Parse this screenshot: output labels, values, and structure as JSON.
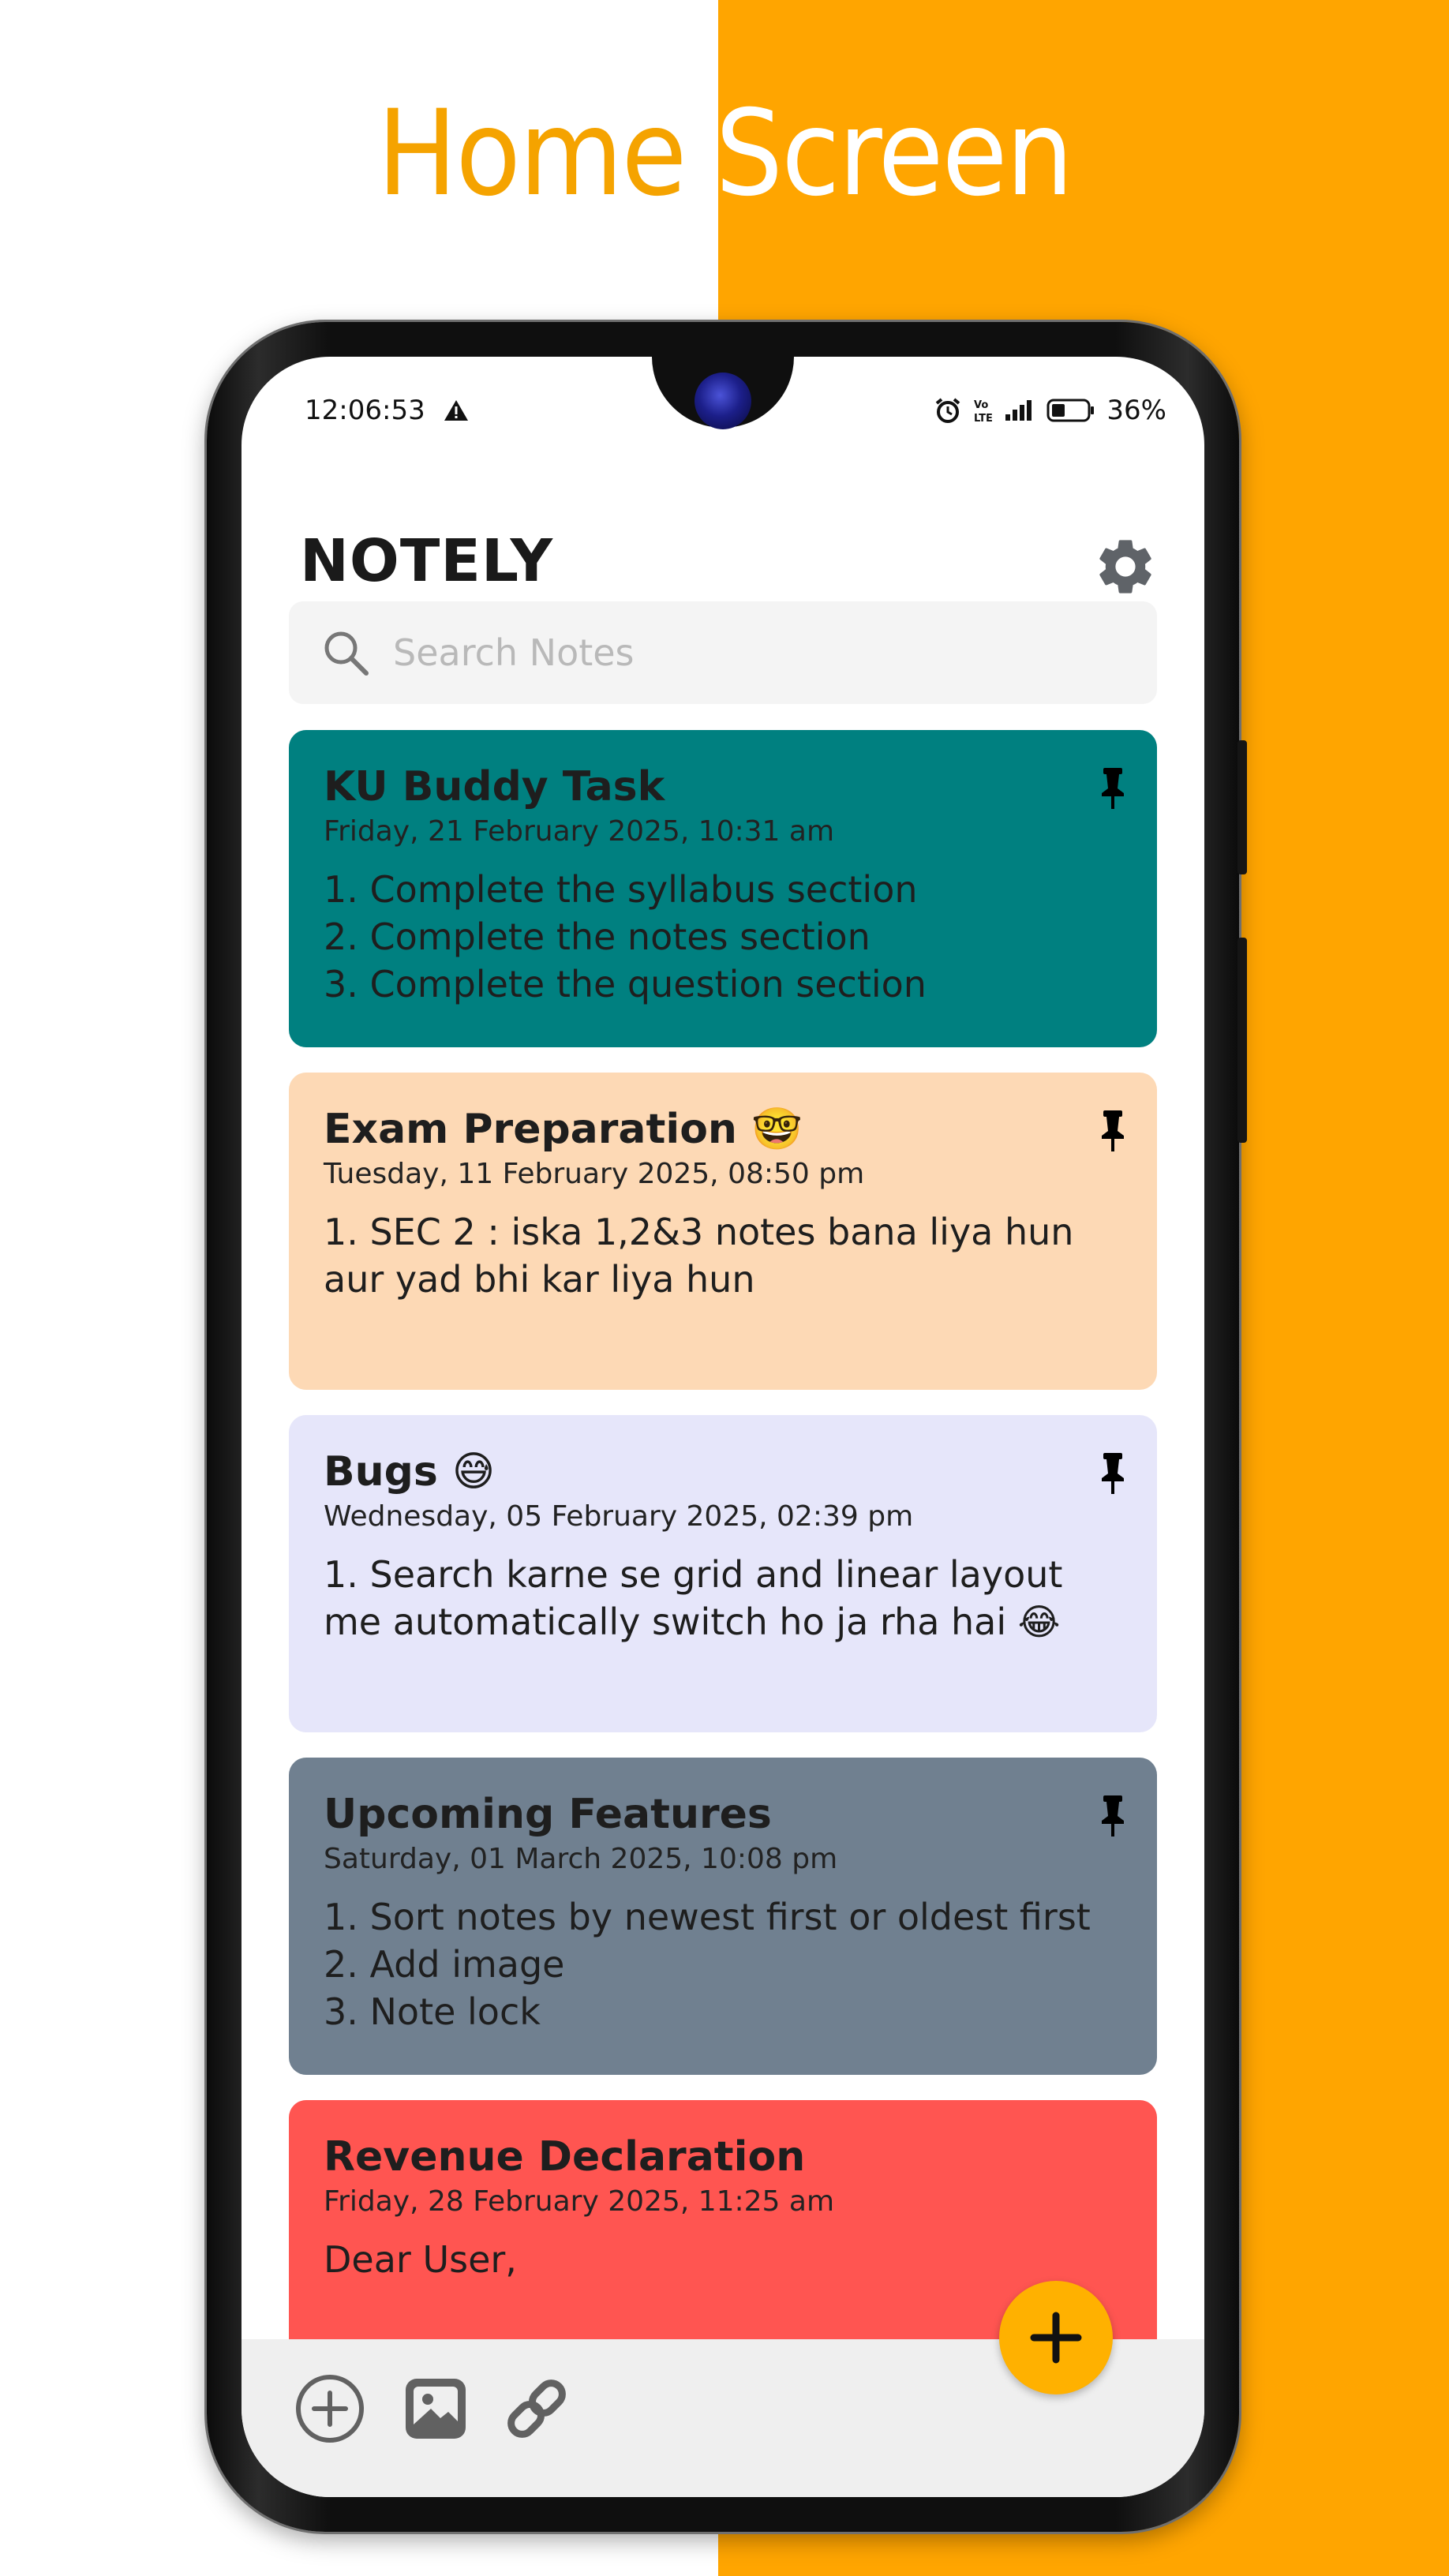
{
  "headline": {
    "word1": "Home",
    "word2": "Screen"
  },
  "status_bar": {
    "time": "12:06:53",
    "battery": "36%",
    "icons": [
      "warning-icon",
      "alarm-icon",
      "volte-icon",
      "signal-icon",
      "battery-icon"
    ]
  },
  "app": {
    "title": "NOTELY",
    "settings_icon": "gear-icon"
  },
  "search": {
    "placeholder": "Search Notes",
    "value": ""
  },
  "notes": [
    {
      "title": "KU Buddy Task",
      "date": "Friday, 21 February 2025, 10:31 am",
      "body": "1. Complete the syllabus section\n2. Complete the notes section\n3. Complete the question section",
      "color": "#008080",
      "pinned": true
    },
    {
      "title": "Exam Preparation 🤓",
      "date": "Tuesday, 11 February 2025, 08:50 pm",
      "body": "1. SEC 2 : iska 1,2&3 notes bana liya hun\naur yad bhi kar liya hun",
      "color": "#FDD9B5",
      "pinned": true
    },
    {
      "title": "Bugs 😅",
      "date": "Wednesday, 05 February 2025, 02:39 pm",
      "body": "1. Search karne se grid and linear layout\nme automatically switch ho ja rha hai 😂",
      "color": "#E6E6FA",
      "pinned": true
    },
    {
      "title": "Upcoming Features",
      "date": "Saturday, 01 March 2025, 10:08 pm",
      "body": "1. Sort notes by newest first or oldest first\n2. Add image\n3. Note lock",
      "color": "#708090",
      "pinned": true
    },
    {
      "title": "Revenue Declaration",
      "date": "Friday, 28 February 2025, 11:25 am",
      "body": "Dear User,",
      "color": "#FF5551",
      "pinned": false
    }
  ],
  "bottom_bar": {
    "icons": [
      "add-circle-icon",
      "image-icon",
      "link-icon"
    ]
  },
  "fab": {
    "icon": "plus-icon",
    "color": "#FFB100"
  },
  "colors": {
    "accent": "#FFA500",
    "headline_orange": "#F5A300"
  }
}
